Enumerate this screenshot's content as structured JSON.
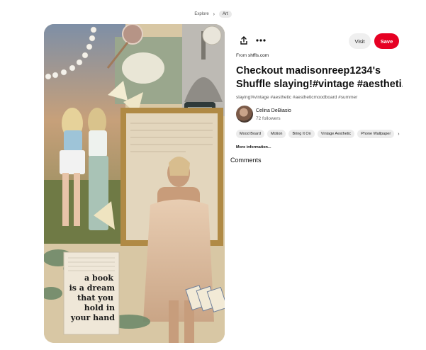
{
  "breadcrumb": {
    "items": [
      "Explore",
      "Art"
    ]
  },
  "pin": {
    "source_prefix": "From",
    "source_domain": "shffls.com",
    "title_line1": "Checkout madisonreep1234's",
    "title_line2": "Shuffle slaying!#vintage #aestheti...",
    "hashtags": "slaying!#vintage #aesthetic #aestheticmoodboard #summer",
    "collage_text": [
      "a book",
      "is a dream",
      "that you",
      "hold in",
      "your hand"
    ]
  },
  "actions": {
    "visit_label": "Visit",
    "save_label": "Save",
    "share_icon": "share-icon",
    "more_icon": "more-icon"
  },
  "creator": {
    "name": "Celina DeBiasio",
    "followers": "72 followers"
  },
  "tags": [
    "Mood Board",
    "Motion",
    "Bring It On",
    "Vintage Aesthetic",
    "Phone Wallpaper"
  ],
  "more_info_label": "More information...",
  "comments_label": "Comments"
}
